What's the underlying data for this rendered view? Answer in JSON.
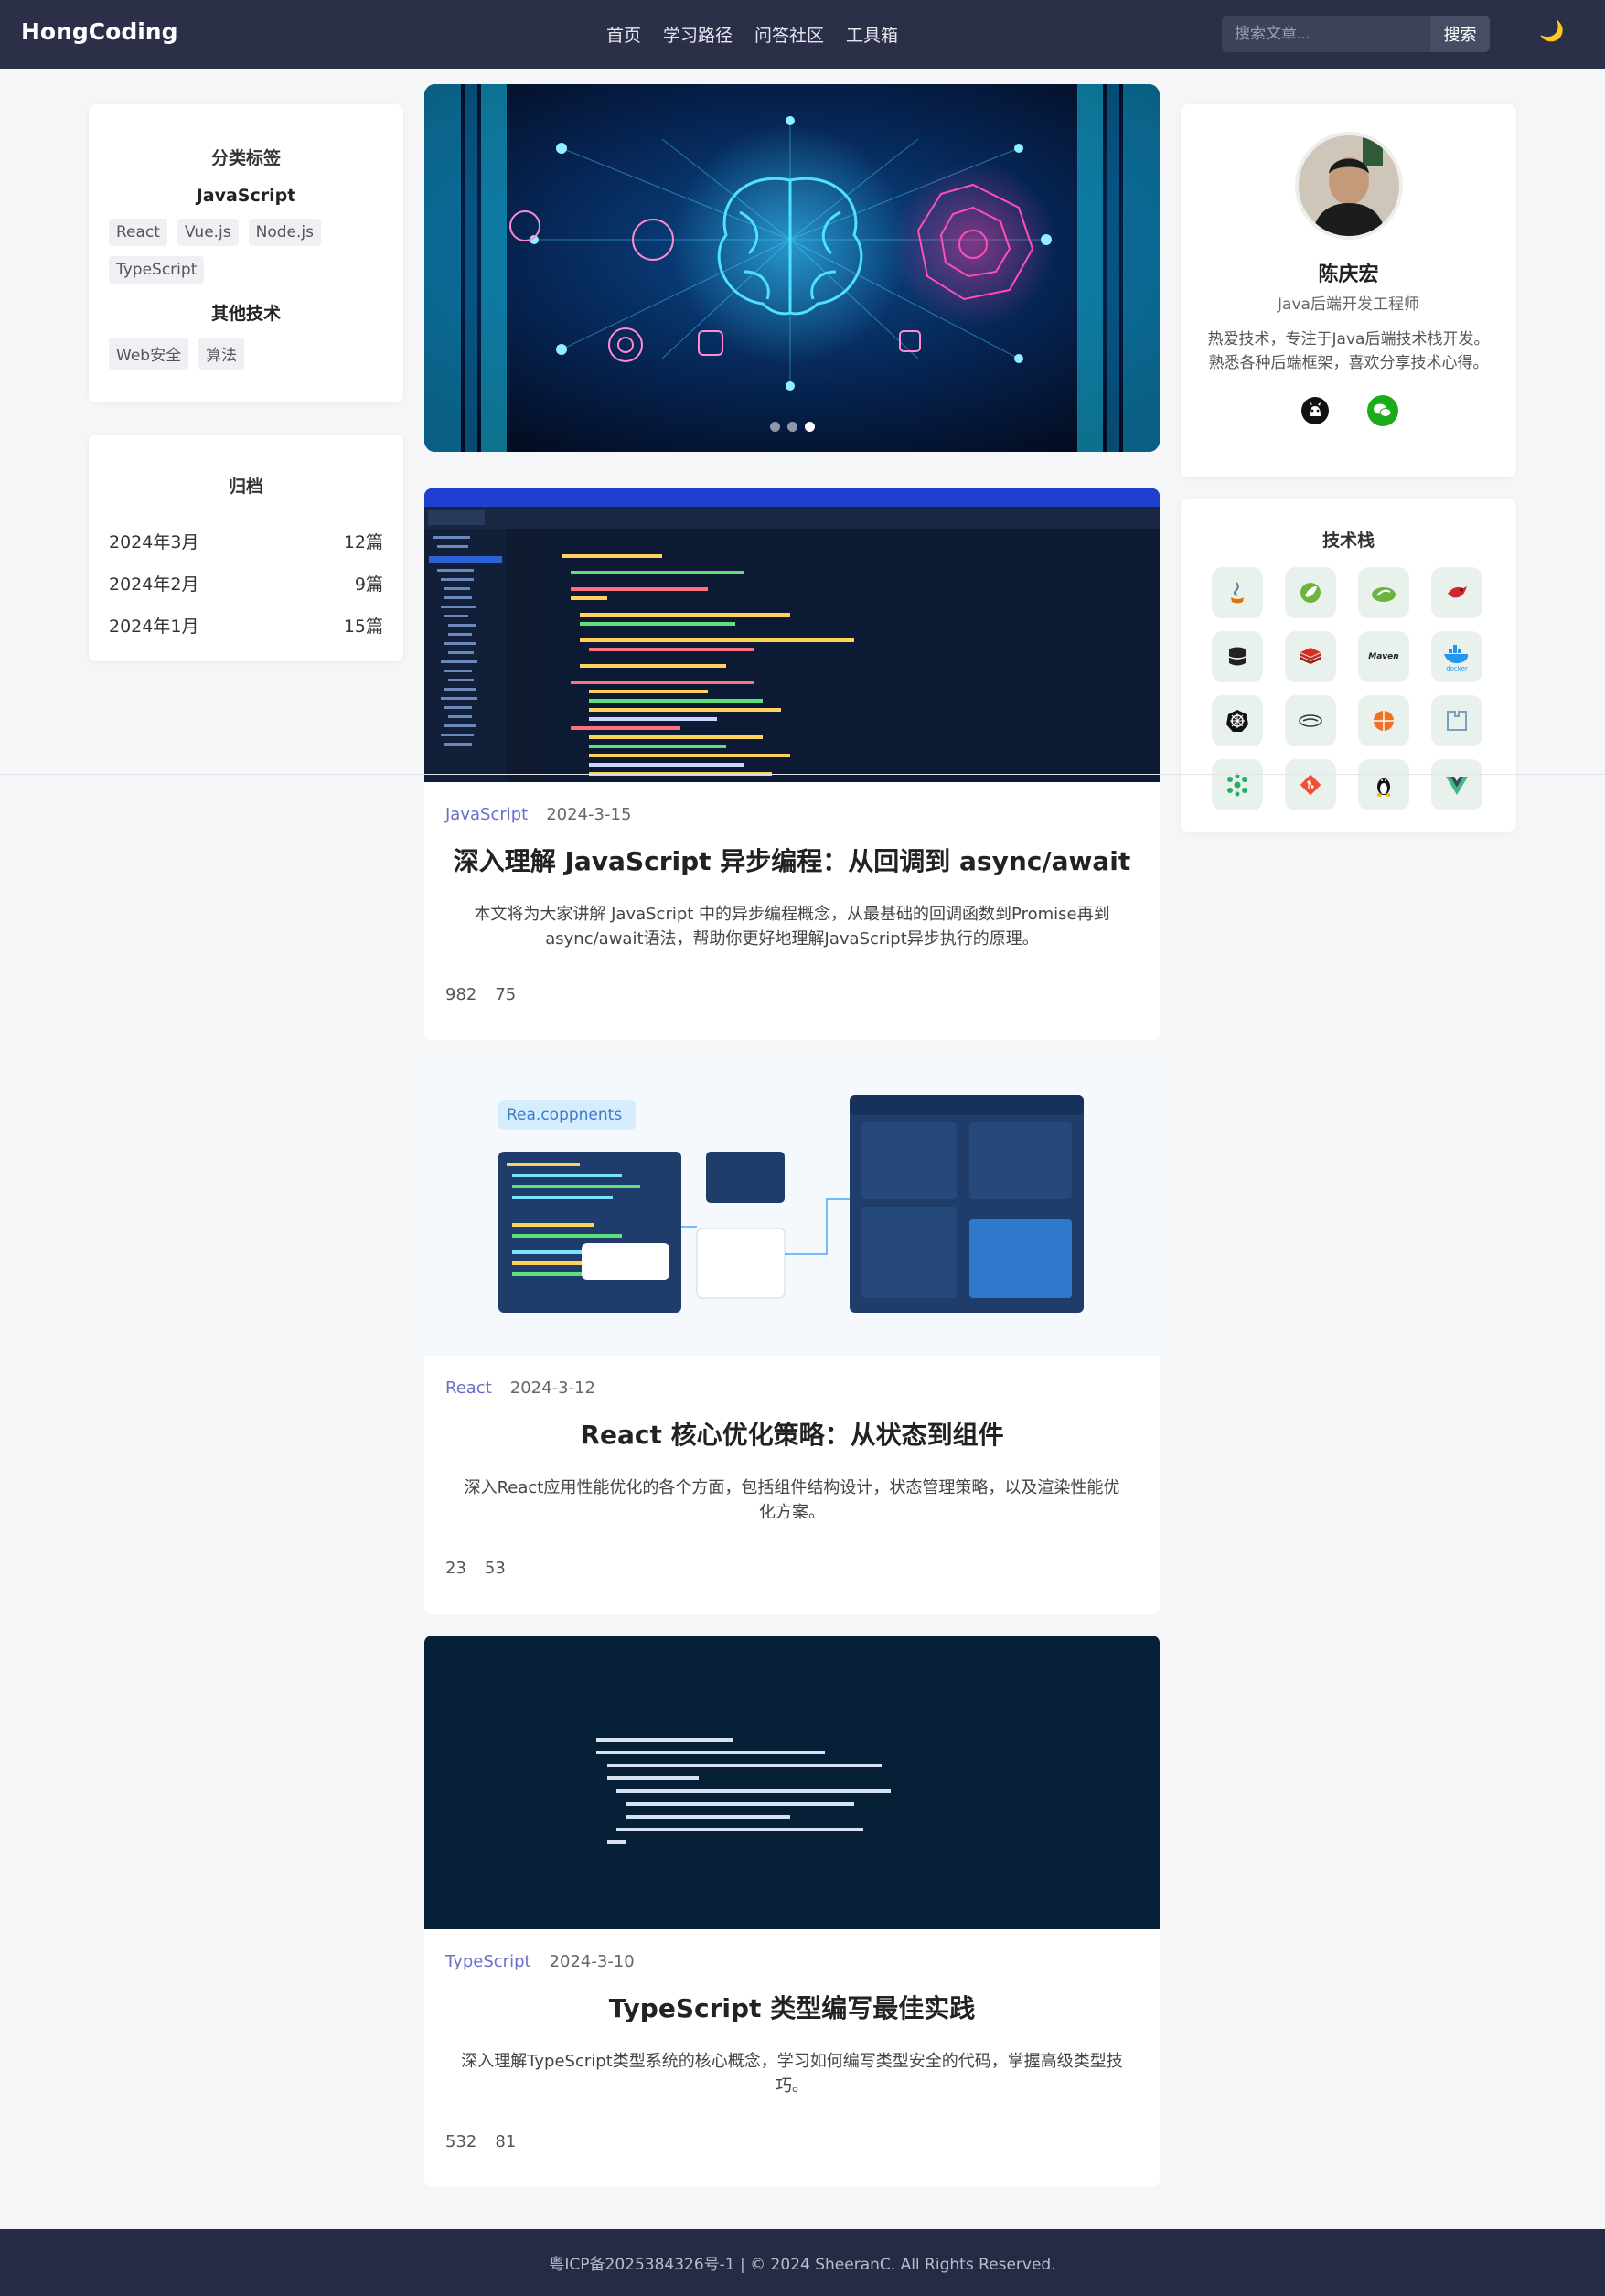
{
  "header": {
    "logo": "HongCoding",
    "nav": [
      "首页",
      "学习路径",
      "问答社区",
      "工具箱"
    ],
    "search_placeholder": "搜索文章...",
    "search_button": "搜索",
    "theme_icon": "moon-icon"
  },
  "tags": {
    "title": "分类标签",
    "groups": [
      {
        "name": "JavaScript",
        "tags": [
          "React",
          "Vue.js",
          "Node.js",
          "TypeScript"
        ]
      },
      {
        "name": "其他技术",
        "tags": [
          "Web安全",
          "算法"
        ]
      }
    ]
  },
  "archive": {
    "title": "归档",
    "items": [
      {
        "month": "2024年3月",
        "count": "12篇"
      },
      {
        "month": "2024年2月",
        "count": "9篇"
      },
      {
        "month": "2024年1月",
        "count": "15篇"
      }
    ]
  },
  "banner": {
    "slides": 3,
    "active_slide": 3
  },
  "articles": [
    {
      "category": "JavaScript",
      "date": "2024-3-15",
      "title": "深入理解 JavaScript 异步编程：从回调到 async/await",
      "excerpt": "本文将为大家讲解 JavaScript 中的异步编程概念，从最基础的回调函数到Promise再到async/await语法，帮助你更好地理解JavaScript异步执行的原理。",
      "views": "982",
      "likes": "75"
    },
    {
      "category": "React",
      "date": "2024-3-12",
      "title": "React 核心优化策略：从状态到组件",
      "excerpt": "深入React应用性能优化的各个方面，包括组件结构设计，状态管理策略，以及渲染性能优化方案。",
      "views": "23",
      "likes": "53",
      "thumb_label": "Rea.coppnents"
    },
    {
      "category": "TypeScript",
      "date": "2024-3-10",
      "title": "TypeScript 类型编写最佳实践",
      "excerpt": "深入理解TypeScript类型系统的核心概念，学习如何编写类型安全的代码，掌握高级类型技巧。",
      "views": "532",
      "likes": "81"
    }
  ],
  "profile": {
    "name": "陈庆宏",
    "role": "Java后端开发工程师",
    "bio": "热爱技术，专注于Java后端技术栈开发。熟悉各种后端框架，喜欢分享技术心得。",
    "social": [
      "github-icon",
      "wechat-icon"
    ]
  },
  "stack": {
    "title": "技术栈",
    "icons": [
      "java-icon",
      "spring-icon",
      "spring-cloud-icon",
      "redis-bird-icon",
      "database-icon",
      "redis-icon",
      "maven-icon",
      "docker-icon",
      "kubernetes-icon",
      "mybatis-icon",
      "network-icon",
      "nacos-icon",
      "cluster-icon",
      "git-icon",
      "linux-icon",
      "vue-icon"
    ],
    "maven_label": "Maven",
    "docker_label": "docker"
  },
  "footer": {
    "text": "粤ICP备2025384326号-1 | © 2024 SheeranC. All Rights Reserved."
  },
  "colors": {
    "header": "#2b3048",
    "footer": "#262b45",
    "accent": "#6a6fc8"
  }
}
